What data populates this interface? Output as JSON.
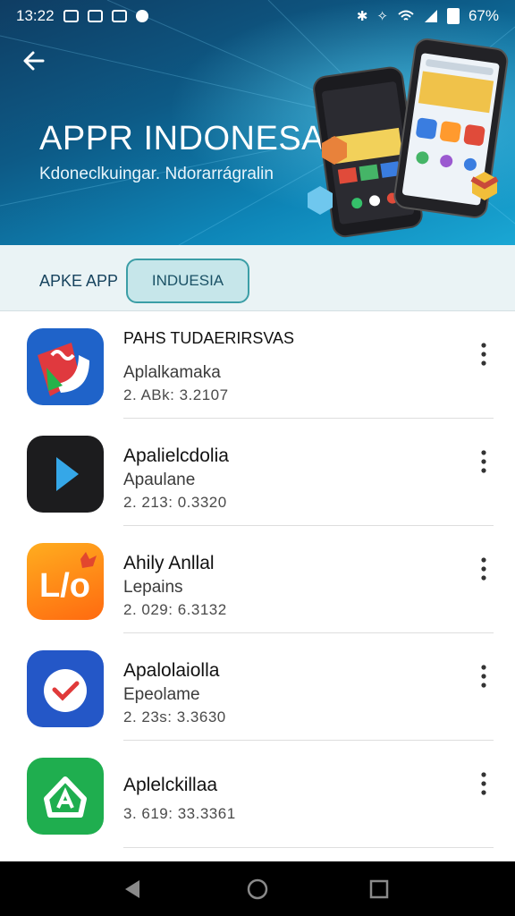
{
  "status_bar": {
    "time": "13:22",
    "battery": "67%"
  },
  "hero": {
    "title": "APPR INDONESA",
    "subtitle": "Kdoneclkuingar. Ndorarrágralin"
  },
  "tabs": [
    {
      "label": "APKE APP",
      "active": false
    },
    {
      "label": "INDUESIA",
      "active": true
    }
  ],
  "apps": [
    {
      "name": "PAHS TUDAERIRSVAS",
      "subtitle": "Aplalkamaka",
      "version": "2. ABk: 3.2107",
      "icon": "red-swirl-icon",
      "icon_bg": "#1f63c9"
    },
    {
      "name": "Apalielcdolia",
      "subtitle": "Apaulane",
      "version": "2. 213: 0.3320",
      "icon": "play-icon",
      "icon_bg": "#1c1c1e"
    },
    {
      "name": "Ahily Anllal",
      "subtitle": "Lepains",
      "version": "2. 029: 6.3132",
      "icon": "lo-logo-icon",
      "icon_bg": "#ff7a12"
    },
    {
      "name": "Apalolaiolla",
      "subtitle": "Epeolame",
      "version": "2. 23s: 3.3630",
      "icon": "check-badge-icon",
      "icon_bg": "#2457c7"
    },
    {
      "name": "Aplelckillaa",
      "subtitle": "",
      "version": "3. 619: 33.3361",
      "icon": "house-a-icon",
      "icon_bg": "#1fae4f"
    }
  ]
}
